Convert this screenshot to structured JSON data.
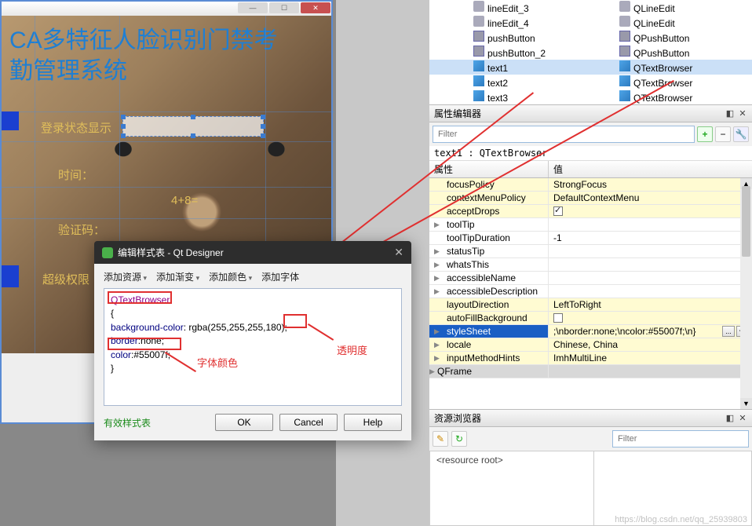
{
  "preview": {
    "app_title": "CA多特征人脸识别门禁考勤管理系统",
    "labels": {
      "login_status": "登录状态显示",
      "time": "时间：",
      "verify": "验证码：",
      "math": "4+8=",
      "super": "超级权限"
    }
  },
  "dialog": {
    "title": "编辑样式表 - Qt Designer",
    "toolbar": {
      "add_resource": "添加资源",
      "add_gradient": "添加渐变",
      "add_color": "添加颜色",
      "add_font": "添加字体"
    },
    "css": {
      "selector": "QTextBrowser",
      "prop_bg": "background-color",
      "val_bg_pre": ": rgba(255,255,255,",
      "val_bg_alpha": "180",
      "val_bg_post": ");",
      "prop_border": "border",
      "val_border": ":none;",
      "prop_color": "color",
      "val_color": ":#55007f;",
      "brace_open": "{",
      "brace_close": "}"
    },
    "annotations": {
      "opacity": "透明度",
      "font_color": "字体颜色"
    },
    "valid": "有效样式表",
    "ok": "OK",
    "cancel": "Cancel",
    "help": "Help"
  },
  "object_tree": [
    {
      "name": "lineEdit_3",
      "class": "QLineEdit",
      "icon": "le"
    },
    {
      "name": "lineEdit_4",
      "class": "QLineEdit",
      "icon": "le"
    },
    {
      "name": "pushButton",
      "class": "QPushButton",
      "icon": "pb"
    },
    {
      "name": "pushButton_2",
      "class": "QPushButton",
      "icon": "pb"
    },
    {
      "name": "text1",
      "class": "QTextBrowser",
      "icon": "tb",
      "selected": true
    },
    {
      "name": "text2",
      "class": "QTextBrowser",
      "icon": "tb"
    },
    {
      "name": "text3",
      "class": "QTextBrowser",
      "icon": "tb"
    }
  ],
  "property_editor": {
    "title": "属性编辑器",
    "filter_placeholder": "Filter",
    "class_label": "text1 : QTextBrowser",
    "col_prop": "属性",
    "col_val": "值",
    "rows": [
      {
        "name": "focusPolicy",
        "value": "StrongFocus",
        "yellow": true
      },
      {
        "name": "contextMenuPolicy",
        "value": "DefaultContextMenu",
        "yellow": true
      },
      {
        "name": "acceptDrops",
        "value": "",
        "yellow": true,
        "check": "checked"
      },
      {
        "name": "toolTip",
        "value": "",
        "expand": true
      },
      {
        "name": "toolTipDuration",
        "value": "-1"
      },
      {
        "name": "statusTip",
        "value": "",
        "expand": true
      },
      {
        "name": "whatsThis",
        "value": "",
        "expand": true
      },
      {
        "name": "accessibleName",
        "value": "",
        "expand": true
      },
      {
        "name": "accessibleDescription",
        "value": "",
        "expand": true
      },
      {
        "name": "layoutDirection",
        "value": "LeftToRight",
        "yellow": true
      },
      {
        "name": "autoFillBackground",
        "value": "",
        "yellow": true,
        "check": "unchecked"
      },
      {
        "name": "styleSheet",
        "value": ";\\nborder:none;\\ncolor:#55007f;\\n}",
        "selected": true,
        "yellow": true,
        "expand": true,
        "dots": true
      },
      {
        "name": "locale",
        "value": "Chinese, China",
        "yellow": true,
        "expand": true
      },
      {
        "name": "inputMethodHints",
        "value": "ImhMultiLine",
        "yellow": true,
        "expand": true
      }
    ],
    "group": "QFrame"
  },
  "resource_browser": {
    "title": "资源浏览器",
    "filter_placeholder": "Filter",
    "root": "<resource root>"
  },
  "watermark": "https://blog.csdn.net/qq_25939803"
}
